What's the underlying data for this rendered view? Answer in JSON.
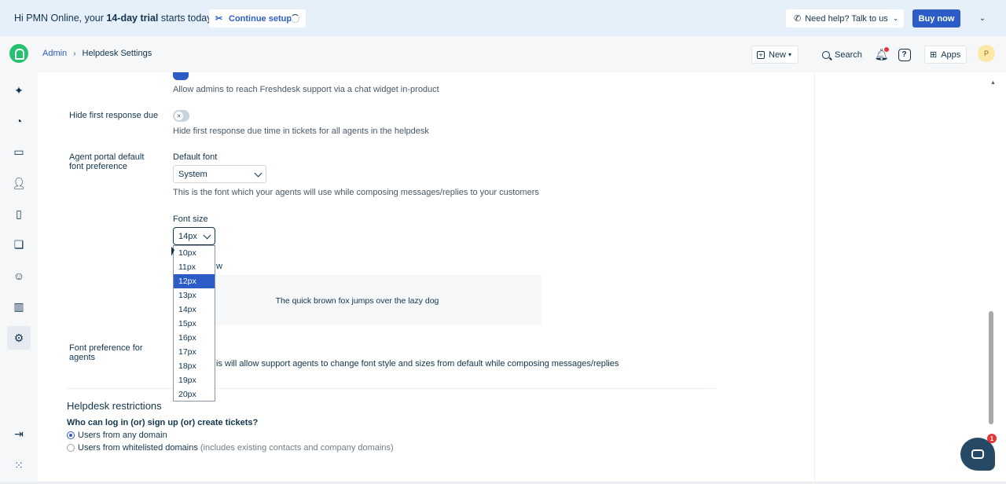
{
  "banner": {
    "text_prefix": "Hi PMN Online, your ",
    "text_bold": "14-day trial",
    "text_suffix": " starts today.",
    "continue_label": "Continue setup",
    "help_label": "Need help? Talk to us",
    "buy_label": "Buy now"
  },
  "header": {
    "breadcrumb_root": "Admin",
    "breadcrumb_current": "Helpdesk Settings",
    "new_label": "New",
    "search_label": "Search",
    "apps_label": "Apps",
    "avatar_initial": "P"
  },
  "settings": {
    "chat_widget_desc": "Allow admins to reach Freshdesk support via a chat widget in-product",
    "hide_first_response_label": "Hide first response due",
    "hide_first_response_desc": "Hide first response due time in tickets for all agents in the helpdesk",
    "agent_portal_label_line1": "Agent portal default",
    "agent_portal_label_line2": "font preference",
    "default_font_label": "Default font",
    "default_font_value": "System",
    "default_font_desc": "This is the font which your agents will use while composing messages/replies to your customers",
    "font_size_label": "Font size",
    "font_size_value": "14px",
    "preview_label_partial": "w",
    "preview_text": "The quick brown fox jumps over the lazy dog",
    "font_pref_agents_line1": "Font preference for",
    "font_pref_agents_line2": "agents",
    "font_pref_agents_desc_partial": "is will allow support agents to change font style and sizes from default while composing messages/replies"
  },
  "font_size_options": [
    "10px",
    "11px",
    "12px",
    "13px",
    "14px",
    "15px",
    "16px",
    "17px",
    "18px",
    "19px",
    "20px"
  ],
  "font_size_highlighted": "12px",
  "restrictions": {
    "title": "Helpdesk restrictions",
    "question": "Who can log in (or) sign up (or) create tickets?",
    "option_any": "Users from any domain",
    "option_whitelisted": "Users from whitelisted domains",
    "option_whitelisted_hint": "(includes existing contacts and company domains)",
    "selected": "any"
  },
  "chat_badge_count": "1",
  "colors": {
    "accent": "#2c5cc5",
    "brand_green": "#25c16f",
    "banner_bg": "#e6f0fb",
    "text": "#12344d"
  }
}
